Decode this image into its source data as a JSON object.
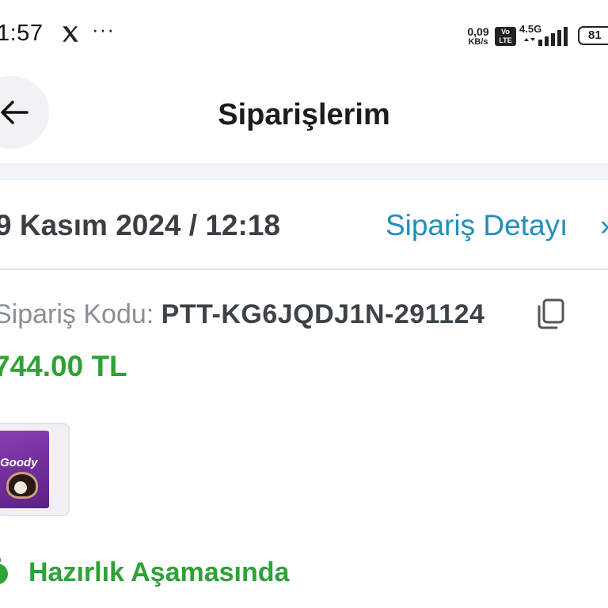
{
  "status_bar": {
    "time": "1:57",
    "x_app_icon": "x-logo-icon",
    "more": "···",
    "net_speed_value": "0,09",
    "net_speed_unit": "KB/s",
    "volte_line1": "Vo",
    "volte_line2": "LTE",
    "network_type": "4.5G",
    "battery": "81"
  },
  "header": {
    "back_icon": "arrow-left-icon",
    "title": "Siparişlerim"
  },
  "order": {
    "date": "9 Kasım 2024 / 12:18",
    "detail_link": "Sipariş Detayı",
    "detail_chevron": "›",
    "code_label": "Sipariş Kodu: ",
    "code_value": "PTT-KG6JQDJ1N-291124",
    "total": "744.00 TL",
    "product": {
      "brand": "Goody"
    },
    "status": "Hazırlık Aşamasında"
  },
  "colors": {
    "accent_blue": "#1e8fbf",
    "success_green": "#2ea236",
    "text_dark": "#3b3f44",
    "text_muted": "#8a8f95"
  }
}
